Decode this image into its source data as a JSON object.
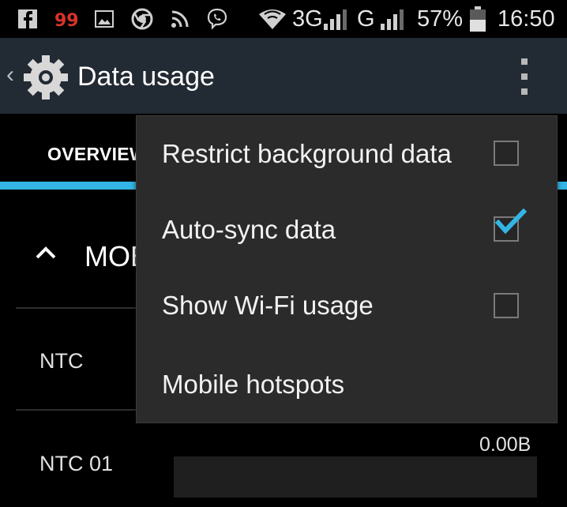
{
  "status_bar": {
    "network_3g": "3G",
    "network_g": "G",
    "battery": "57%",
    "time": "16:50",
    "icons": [
      "facebook-icon",
      "notification-icon",
      "image-icon",
      "chrome-icon",
      "rss-icon",
      "viber-icon",
      "wifi-icon",
      "signal-icon",
      "battery-icon"
    ]
  },
  "action_bar": {
    "title": "Data usage",
    "app_icon": "settings-gear-icon",
    "overflow_icon": "overflow-menu-icon"
  },
  "tabs": {
    "overview_label": "OVERVIEW"
  },
  "content": {
    "section_title": "MOB",
    "rows": [
      {
        "label": "NTC"
      },
      {
        "label": "NTC 01",
        "usage": "0.00B"
      }
    ]
  },
  "menu": {
    "items": [
      {
        "label": "Restrict background data",
        "checkbox": true,
        "checked": false
      },
      {
        "label": "Auto-sync data",
        "checkbox": true,
        "checked": true
      },
      {
        "label": "Show Wi-Fi usage",
        "checkbox": true,
        "checked": false
      },
      {
        "label": "Mobile hotspots",
        "checkbox": false
      }
    ]
  },
  "colors": {
    "accent": "#33b5e5",
    "action_bar": "#222a33",
    "menu_bg": "#2b2b2b"
  }
}
